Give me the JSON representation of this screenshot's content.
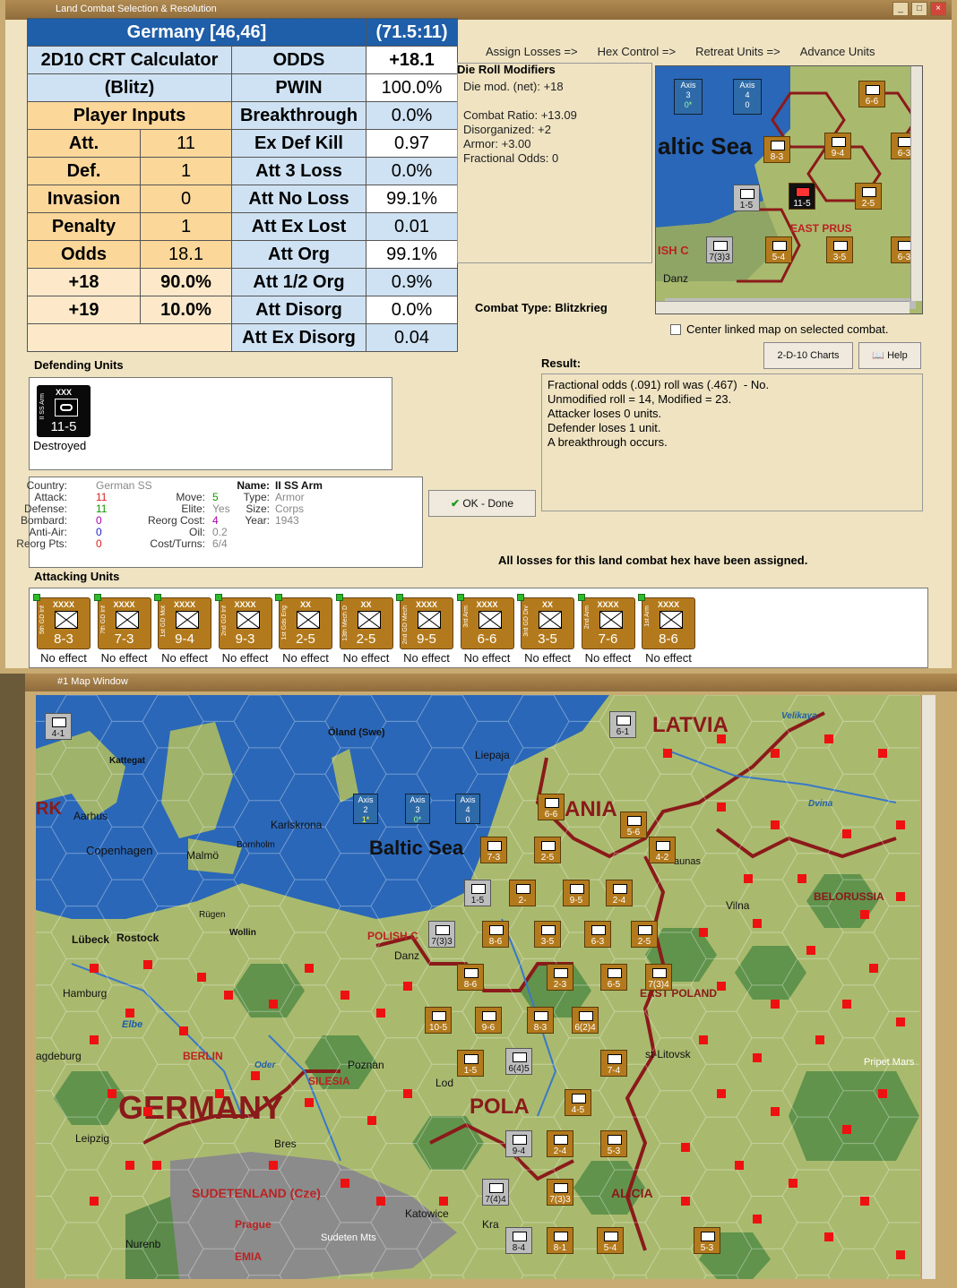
{
  "window1": {
    "title": "Land Combat Selection & Resolution"
  },
  "crt": {
    "header_left": "Germany [46,46]",
    "header_right": "(71.5:11)",
    "calc_line1": "2D10 CRT Calculator",
    "calc_line2": "(Blitz)",
    "player_inputs": "Player Inputs",
    "inputs": [
      {
        "label": "Att.",
        "value": "11"
      },
      {
        "label": "Def.",
        "value": "1"
      },
      {
        "label": "Invasion",
        "value": "0"
      },
      {
        "label": "Penalty",
        "value": "1"
      },
      {
        "label": "Odds",
        "value": "18.1"
      }
    ],
    "odds_rows": [
      {
        "label": "+18",
        "value": "90.0%"
      },
      {
        "label": "+19",
        "value": "10.0%"
      }
    ],
    "results": [
      {
        "label": "ODDS",
        "value": "+18.1"
      },
      {
        "label": "PWIN",
        "value": "100.0%"
      },
      {
        "label": "Breakthrough",
        "value": "0.0%"
      },
      {
        "label": "Ex Def Kill",
        "value": "0.97"
      },
      {
        "label": "Att 3 Loss",
        "value": "0.0%"
      },
      {
        "label": "Att No Loss",
        "value": "99.1%"
      },
      {
        "label": "Att Ex Lost",
        "value": "0.01"
      },
      {
        "label": "Att Org",
        "value": "99.1%"
      },
      {
        "label": "Att 1/2 Org",
        "value": "0.9%"
      },
      {
        "label": "Att Disorg",
        "value": "0.0%"
      },
      {
        "label": "Att Ex Disorg",
        "value": "0.04"
      }
    ]
  },
  "tabs": [
    "Assign Losses =>",
    "Hex Control =>",
    "Retreat Units =>",
    "Advance Units"
  ],
  "die_roll": {
    "title": "Die Roll Modifiers",
    "lines": "Die mod. (net): +18\n\nCombat Ratio: +13.09\nDisorganized: +2\nArmor: +3.00\nFractional Odds: 0"
  },
  "combat_type": "Combat Type:  Blitzkrieg",
  "center_linked": "Center linked map on selected combat.",
  "buttons": {
    "charts": "2-D-10 Charts",
    "help": "Help",
    "ok": "OK - Done"
  },
  "defending": {
    "label": "Defending Units",
    "unit": {
      "size": "XXX",
      "strength": "11-5",
      "name": "II SS Arm",
      "status": "Destroyed"
    }
  },
  "result": {
    "label": "Result:",
    "text": "Fractional odds (.091) roll was (.467)  - No.\nUnmodified roll = 14, Modified = 23.\nAttacker loses 0 units.\nDefender loses 1 unit.\nA breakthrough occurs."
  },
  "unit_info": {
    "country_label": "Country:",
    "country": "German SS",
    "attack_label": "Attack:",
    "attack": "11",
    "defense_label": "Defense:",
    "defense": "11",
    "bombard_label": "Bombard:",
    "bombard": "0",
    "antiair_label": "Anti-Air:",
    "antiair": "0",
    "reorgpts_label": "Reorg Pts:",
    "reorgpts": "0",
    "move_label": "Move:",
    "move": "5",
    "elite_label": "Elite:",
    "elite": "Yes",
    "reorgcost_label": "Reorg Cost:",
    "reorgcost": "4",
    "oil_label": "Oil:",
    "oil": "0.2",
    "costturns_label": "Cost/Turns:",
    "costturns": "6/4",
    "name_label": "Name:",
    "name": "II SS Arm",
    "type_label": "Type:",
    "type": "Armor",
    "size_label": "Size:",
    "size": "Corps",
    "year_label": "Year:",
    "year": "1943"
  },
  "all_losses": "All losses for this land combat hex have been assigned.",
  "attacking": {
    "label": "Attacking Units",
    "units": [
      {
        "size": "XXXX",
        "strength": "8-3",
        "name": "5th GD Inf",
        "status": "No effect"
      },
      {
        "size": "XXXX",
        "strength": "7-3",
        "name": "7th GD Inf",
        "status": "No effect"
      },
      {
        "size": "XXXX",
        "strength": "9-4",
        "name": "1st GD Mot",
        "status": "No effect"
      },
      {
        "size": "XXXX",
        "strength": "9-3",
        "name": "2nd GD Inf",
        "status": "No effect"
      },
      {
        "size": "XX",
        "strength": "2-5",
        "name": "1st Gds Eng",
        "status": "No effect"
      },
      {
        "size": "XX",
        "strength": "2-5",
        "name": "13th Mech D",
        "status": "No effect"
      },
      {
        "size": "XXXX",
        "strength": "9-5",
        "name": "2nd GD Mech",
        "status": "No effect"
      },
      {
        "size": "XXXX",
        "strength": "6-6",
        "name": "3rd Arm",
        "status": "No effect"
      },
      {
        "size": "XX",
        "strength": "3-5",
        "name": "3rd GD Div",
        "status": "No effect"
      },
      {
        "size": "XXXX",
        "strength": "7-6",
        "name": "2nd Arm",
        "status": "No effect"
      },
      {
        "size": "XXXX",
        "strength": "8-6",
        "name": "1st Arm",
        "status": "No effect"
      }
    ]
  },
  "minimap": {
    "axis": [
      {
        "label": "Axis",
        "num": "3",
        "sub": "0*"
      },
      {
        "label": "Axis",
        "num": "4",
        "sub": "0"
      }
    ],
    "labels": [
      "altic Sea",
      "EAST PRUS",
      "ISH C",
      "Danz"
    ],
    "counters": [
      "8-3",
      "9-4",
      "6-6",
      "6-3",
      "1-5",
      "11-5",
      "2-5",
      "7(3)3",
      "5-4",
      "3-5",
      "6-3"
    ]
  },
  "map_window": {
    "title": "#1 Map Window",
    "labels": [
      {
        "text": "LATVIA"
      },
      {
        "text": "Velikaya"
      },
      {
        "text": "Öland (Swe)"
      },
      {
        "text": "Liepaja"
      },
      {
        "text": "Kattegat"
      },
      {
        "text": "RK"
      },
      {
        "text": "Aarhus"
      },
      {
        "text": "Karlskrona"
      },
      {
        "text": "ANIA"
      },
      {
        "text": "Dvina"
      },
      {
        "text": "Copenhagen"
      },
      {
        "text": "Malmö"
      },
      {
        "text": "Bornholm"
      },
      {
        "text": "Baltic Sea"
      },
      {
        "text": "aunas"
      },
      {
        "text": "BELORUSSIA"
      },
      {
        "text": "Vilna"
      },
      {
        "text": "Rügen"
      },
      {
        "text": "Wollin"
      },
      {
        "text": "Lübeck"
      },
      {
        "text": "Rostock"
      },
      {
        "text": "POLISH C"
      },
      {
        "text": "Danz"
      },
      {
        "text": "Hamburg"
      },
      {
        "text": "EAST POLAND"
      },
      {
        "text": "Elbe"
      },
      {
        "text": "BERLIN"
      },
      {
        "text": "agdeburg"
      },
      {
        "text": "Oder"
      },
      {
        "text": "Poznan"
      },
      {
        "text": "SILESIA"
      },
      {
        "text": "Lod"
      },
      {
        "text": "st-Litovsk"
      },
      {
        "text": "Pripet Mars"
      },
      {
        "text": "GERMANY"
      },
      {
        "text": "POLA"
      },
      {
        "text": "Leipzig"
      },
      {
        "text": "Bres"
      },
      {
        "text": "SUDETENLAND (Cze)"
      },
      {
        "text": "ALICIA"
      },
      {
        "text": "Prague"
      },
      {
        "text": "Katowice"
      },
      {
        "text": "Kra"
      },
      {
        "text": "Sudeten Mts"
      },
      {
        "text": "Nurenb"
      },
      {
        "text": "EMIA"
      }
    ],
    "axis": [
      {
        "label": "Axis",
        "num": "2",
        "sub": "1*"
      },
      {
        "label": "Axis",
        "num": "3",
        "sub": "0*"
      },
      {
        "label": "Axis",
        "num": "4",
        "sub": "0"
      }
    ],
    "counters": [
      {
        "v": "4-1",
        "t": "grey"
      },
      {
        "v": "6-1",
        "t": "grey"
      },
      {
        "v": "6-6",
        "t": "brown"
      },
      {
        "v": "7-3",
        "t": "brown"
      },
      {
        "v": "2-5",
        "t": "brown"
      },
      {
        "v": "5-6",
        "t": "brown"
      },
      {
        "v": "4-2",
        "t": "brown"
      },
      {
        "v": "1-5",
        "t": "grey"
      },
      {
        "v": "2-",
        "t": "brown"
      },
      {
        "v": "9-5",
        "t": "brown"
      },
      {
        "v": "2-4",
        "t": "brown"
      },
      {
        "v": "7(3)3",
        "t": "grey"
      },
      {
        "v": "8-6",
        "t": "brown"
      },
      {
        "v": "3-5",
        "t": "brown"
      },
      {
        "v": "6-3",
        "t": "brown"
      },
      {
        "v": "2-5",
        "t": "brown"
      },
      {
        "v": "8-6",
        "t": "brown"
      },
      {
        "v": "2-3",
        "t": "brown"
      },
      {
        "v": "6-5",
        "t": "brown"
      },
      {
        "v": "7(3)4",
        "t": "brown"
      },
      {
        "v": "10-5",
        "t": "brown"
      },
      {
        "v": "9-6",
        "t": "brown"
      },
      {
        "v": "8-3",
        "t": "brown"
      },
      {
        "v": "6(2)4",
        "t": "brown"
      },
      {
        "v": "1-5",
        "t": "brown"
      },
      {
        "v": "6(4)5",
        "t": "grey"
      },
      {
        "v": "7-4",
        "t": "brown"
      },
      {
        "v": "4-5",
        "t": "brown"
      },
      {
        "v": "9-4",
        "t": "grey"
      },
      {
        "v": "2-4",
        "t": "brown"
      },
      {
        "v": "5-3",
        "t": "brown"
      },
      {
        "v": "7(4)4",
        "t": "grey"
      },
      {
        "v": "7(3)3",
        "t": "brown"
      },
      {
        "v": "8-4",
        "t": "grey"
      },
      {
        "v": "8-1",
        "t": "brown"
      },
      {
        "v": "5-4",
        "t": "brown"
      },
      {
        "v": "5-3",
        "t": "brown"
      }
    ]
  },
  "colors": {
    "crt_header": "#1f5ea8",
    "crt_blue": "#cfe2f3",
    "crt_orange": "#fbd79a",
    "counter_brown": "#b37a1d",
    "counter_grey": "#bdbdbd",
    "panel_bg": "#efe3c2"
  }
}
